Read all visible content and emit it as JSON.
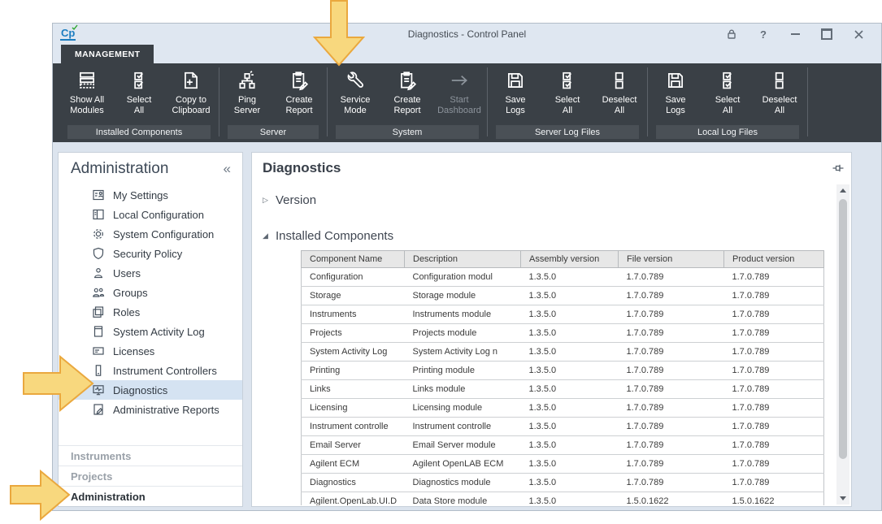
{
  "window": {
    "logo_text": "Cp",
    "title": "Diagnostics - Control Panel",
    "controls": {
      "help_glyph": "?"
    }
  },
  "ribbon": {
    "tab": "MANAGEMENT",
    "groups": [
      {
        "label": "Installed Components",
        "buttons": [
          {
            "line1": "Show All",
            "line2": "Modules",
            "icon": "modules-icon"
          },
          {
            "line1": "Select",
            "line2": "All",
            "icon": "select-all-icon"
          },
          {
            "line1": "Copy to",
            "line2": "Clipboard",
            "icon": "copy-to-clipboard-icon"
          }
        ]
      },
      {
        "label": "Server",
        "buttons": [
          {
            "line1": "Ping",
            "line2": "Server",
            "icon": "ping-server-icon"
          },
          {
            "line1": "Create",
            "line2": "Report",
            "icon": "create-report-icon"
          }
        ]
      },
      {
        "label": "System",
        "buttons": [
          {
            "line1": "Service",
            "line2": "Mode",
            "icon": "wrench-icon"
          },
          {
            "line1": "Create",
            "line2": "Report",
            "icon": "create-report-icon"
          },
          {
            "line1": "Start",
            "line2": "Dashboard",
            "icon": "arrow-right-icon",
            "disabled": true
          }
        ]
      },
      {
        "label": "Server Log Files",
        "buttons": [
          {
            "line1": "Save",
            "line2": "Logs",
            "icon": "save-icon"
          },
          {
            "line1": "Select",
            "line2": "All",
            "icon": "select-all-icon"
          },
          {
            "line1": "Deselect",
            "line2": "All",
            "icon": "deselect-all-icon"
          }
        ]
      },
      {
        "label": "Local Log Files",
        "buttons": [
          {
            "line1": "Save",
            "line2": "Logs",
            "icon": "save-icon"
          },
          {
            "line1": "Select",
            "line2": "All",
            "icon": "select-all-icon"
          },
          {
            "line1": "Deselect",
            "line2": "All",
            "icon": "deselect-all-icon"
          }
        ]
      }
    ]
  },
  "sidebar": {
    "heading": "Administration",
    "collapse_glyph": "«",
    "items": [
      {
        "label": "My Settings",
        "icon": "my-settings-icon"
      },
      {
        "label": "Local Configuration",
        "icon": "local-configuration-icon"
      },
      {
        "label": "System Configuration",
        "icon": "gear-icon"
      },
      {
        "label": "Security Policy",
        "icon": "shield-icon"
      },
      {
        "label": "Users",
        "icon": "user-icon"
      },
      {
        "label": "Groups",
        "icon": "group-icon"
      },
      {
        "label": "Roles",
        "icon": "roles-icon"
      },
      {
        "label": "System Activity Log",
        "icon": "log-icon"
      },
      {
        "label": "Licenses",
        "icon": "license-icon"
      },
      {
        "label": "Instrument Controllers",
        "icon": "controller-icon"
      },
      {
        "label": "Diagnostics",
        "icon": "diagnostics-icon",
        "selected": true
      },
      {
        "label": "Administrative Reports",
        "icon": "report-icon"
      }
    ],
    "bottom_nav": [
      {
        "label": "Instruments",
        "active": false
      },
      {
        "label": "Projects",
        "active": false
      },
      {
        "label": "Administration",
        "active": true
      }
    ]
  },
  "main": {
    "title": "Diagnostics",
    "sections": [
      {
        "label": "Version",
        "expanded": false,
        "glyph": "▷"
      },
      {
        "label": "Installed Components",
        "expanded": true,
        "glyph": "◢"
      }
    ],
    "table": {
      "columns": [
        "Component Name",
        "Description",
        "Assembly version",
        "File version",
        "Product version"
      ],
      "rows": [
        [
          "Configuration",
          "Configuration modul",
          "1.3.5.0",
          "1.7.0.789",
          "1.7.0.789"
        ],
        [
          "Storage",
          "Storage module",
          "1.3.5.0",
          "1.7.0.789",
          "1.7.0.789"
        ],
        [
          "Instruments",
          "Instruments module",
          "1.3.5.0",
          "1.7.0.789",
          "1.7.0.789"
        ],
        [
          "Projects",
          "Projects module",
          "1.3.5.0",
          "1.7.0.789",
          "1.7.0.789"
        ],
        [
          "System Activity Log",
          "System Activity Log n",
          "1.3.5.0",
          "1.7.0.789",
          "1.7.0.789"
        ],
        [
          "Printing",
          "Printing module",
          "1.3.5.0",
          "1.7.0.789",
          "1.7.0.789"
        ],
        [
          "Links",
          "Links module",
          "1.3.5.0",
          "1.7.0.789",
          "1.7.0.789"
        ],
        [
          "Licensing",
          "Licensing module",
          "1.3.5.0",
          "1.7.0.789",
          "1.7.0.789"
        ],
        [
          "Instrument controlle",
          "Instrument controlle",
          "1.3.5.0",
          "1.7.0.789",
          "1.7.0.789"
        ],
        [
          "Email Server",
          "Email Server module",
          "1.3.5.0",
          "1.7.0.789",
          "1.7.0.789"
        ],
        [
          "Agilent ECM",
          "Agilent OpenLAB ECM",
          "1.3.5.0",
          "1.7.0.789",
          "1.7.0.789"
        ],
        [
          "Diagnostics",
          "Diagnostics module",
          "1.3.5.0",
          "1.7.0.789",
          "1.7.0.789"
        ],
        [
          "Agilent.OpenLab.UI.D",
          "Data Store module",
          "1.3.5.0",
          "1.5.0.1622",
          "1.5.0.1622"
        ]
      ]
    }
  },
  "annotations": {
    "arrows": [
      {
        "direction": "down",
        "points_to": "service-mode-button"
      },
      {
        "direction": "right",
        "points_to": "sidebar-item-diagnostics"
      },
      {
        "direction": "right",
        "points_to": "bottom-nav-administration"
      }
    ]
  },
  "colors": {
    "titlebar_bg": "#dfe7f1",
    "ribbon_bg": "#3a4046",
    "group_caption_bg": "#4a5056",
    "window_bg": "#dce4ee",
    "selection_bg": "#d5e3f2",
    "logo_blue": "#1b7dc0",
    "arrow_fill": "#f8d87e",
    "arrow_border": "#eaa83e",
    "table_header_bg": "#e7e7e7"
  }
}
